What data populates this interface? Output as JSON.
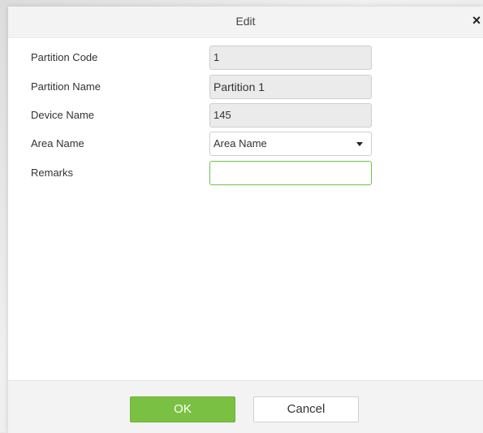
{
  "dialog": {
    "title": "Edit",
    "close_glyph": "×"
  },
  "form": {
    "partition_code": {
      "label": "Partition Code",
      "value": "1"
    },
    "partition_name": {
      "label": "Partition Name",
      "value": "Partition 1"
    },
    "device_name": {
      "label": "Device Name",
      "value": "145"
    },
    "area_name": {
      "label": "Area Name",
      "value": "Area Name"
    },
    "remarks": {
      "label": "Remarks",
      "value": ""
    }
  },
  "buttons": {
    "ok": "OK",
    "cancel": "Cancel"
  },
  "colors": {
    "accent": "#7ac143",
    "focus_border": "#6fc24a"
  },
  "icons": {
    "close": "close-icon",
    "dropdown": "chevron-down-icon"
  }
}
